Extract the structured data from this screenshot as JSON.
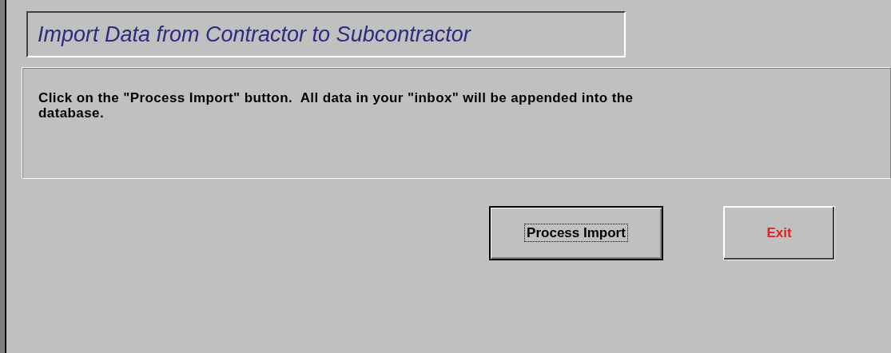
{
  "title": "Import Data from Contractor to Subcontractor",
  "message": "Click on the \"Process Import\" button.  All data in your \"inbox\" will be appended into the database.",
  "buttons": [
    {
      "label": "Process Import",
      "kind": "normal",
      "focused": true
    },
    {
      "label": "Exit",
      "kind": "danger",
      "focused": false
    }
  ]
}
